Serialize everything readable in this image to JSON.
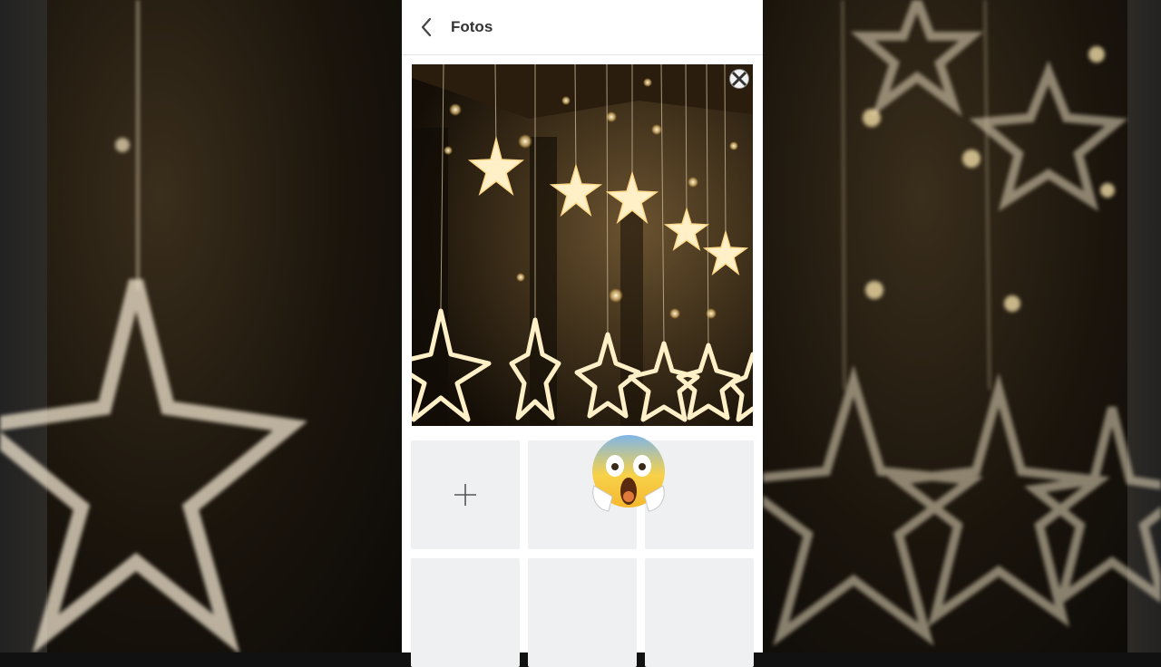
{
  "header": {
    "title": "Fotos",
    "back_icon": "chevron-left-icon"
  },
  "photo": {
    "description_icon": "star-string-lights-photo",
    "remove_icon": "close-icon"
  },
  "grid": {
    "add_icon": "plus-icon",
    "tile_count": 6
  },
  "overlay": {
    "emoji": "face-screaming-in-fear-icon"
  },
  "colors": {
    "tile": "#eef0f2",
    "divider": "#e6e6e6",
    "title": "#333333",
    "light": "#ffe7a6"
  }
}
